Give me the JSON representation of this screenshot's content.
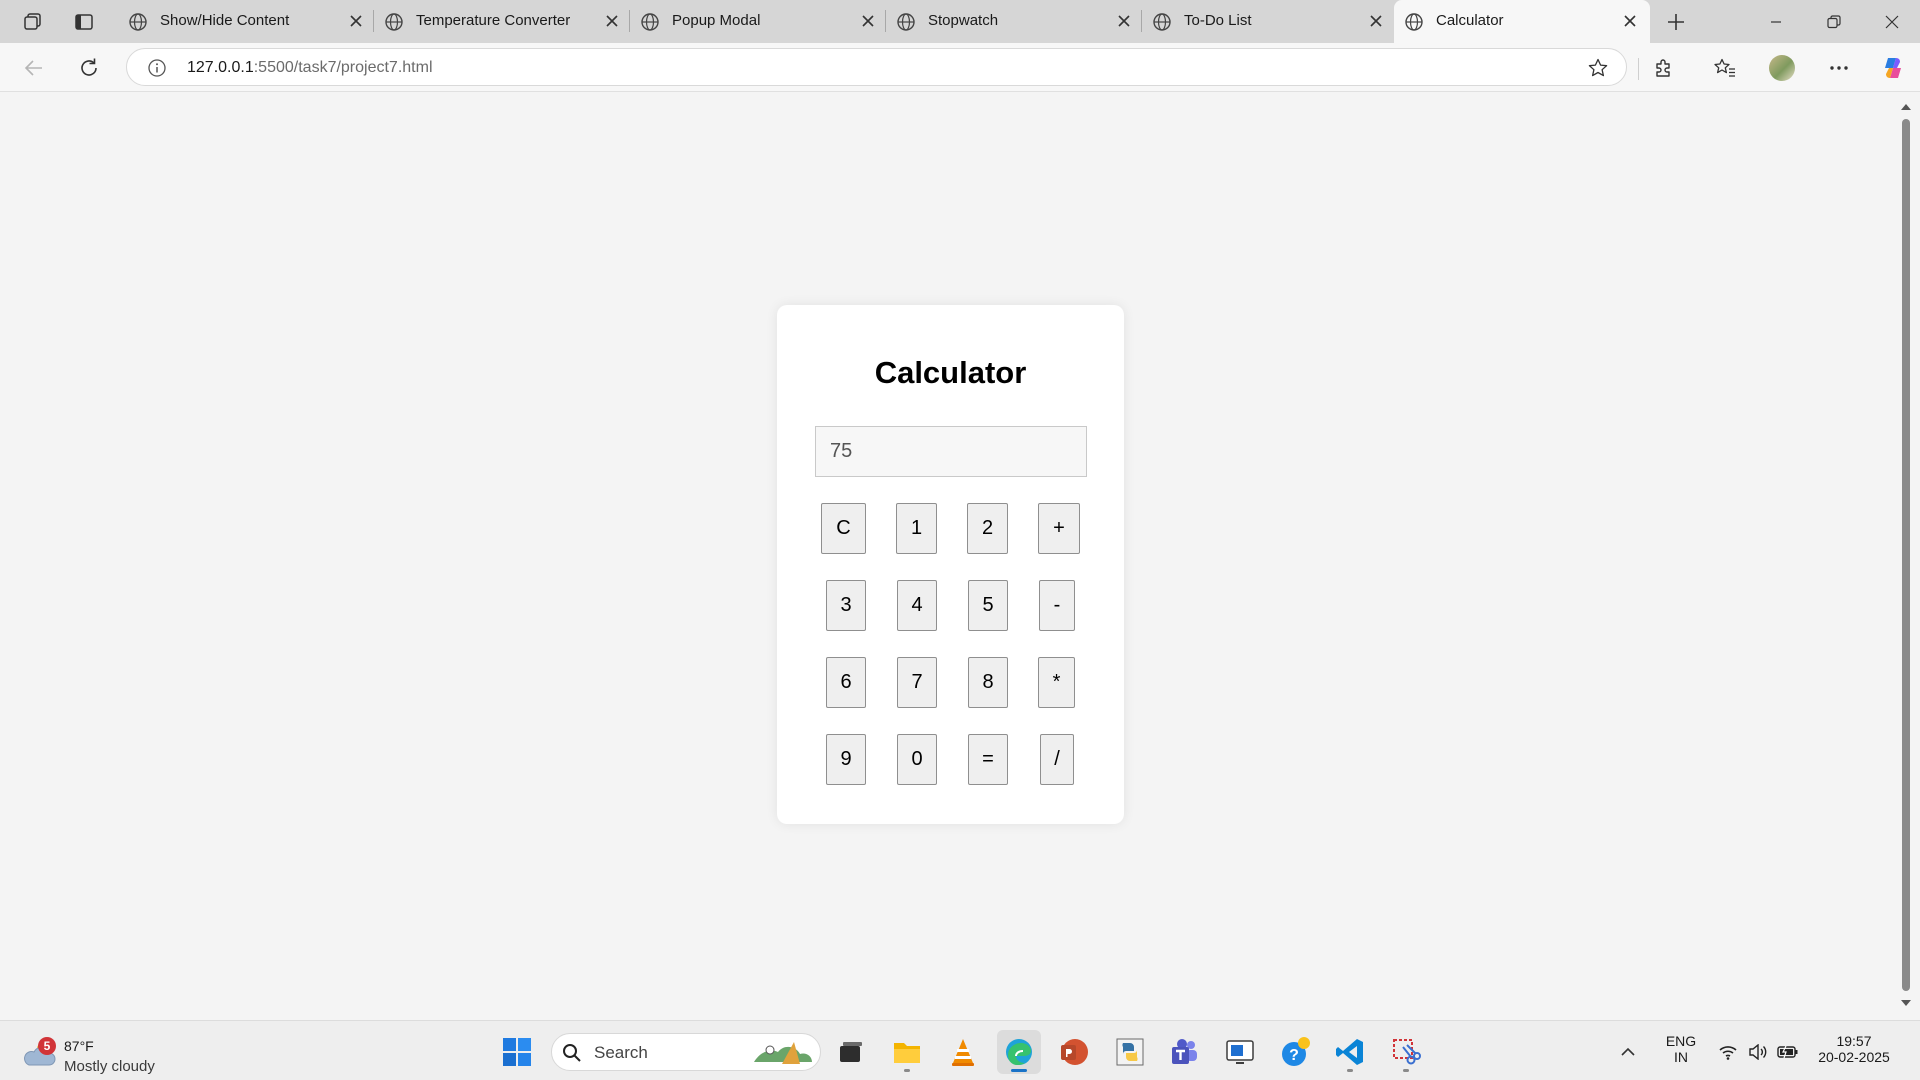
{
  "browser": {
    "tabs": [
      {
        "title": "Show/Hide Content",
        "active": false
      },
      {
        "title": "Temperature Converter",
        "active": false
      },
      {
        "title": "Popup Modal",
        "active": false
      },
      {
        "title": "Stopwatch",
        "active": false
      },
      {
        "title": "To-Do List",
        "active": false
      },
      {
        "title": "Calculator",
        "active": true
      }
    ],
    "address": {
      "host": "127.0.0.1",
      "rest": ":5500/task7/project7.html"
    },
    "icons": {
      "workspaces": "workspaces-icon",
      "tab_actions": "tab-actions-icon",
      "tab": "globe-icon",
      "new_tab": "plus-icon",
      "back": "back-arrow-icon",
      "refresh": "refresh-icon",
      "site_info": "info-icon",
      "favorite": "star-icon",
      "extensions": "puzzle-icon",
      "favorites": "favorites-icon",
      "more": "more-icon",
      "copilot": "copilot-icon"
    }
  },
  "calculator": {
    "title": "Calculator",
    "display_value": "75",
    "keys": [
      "C",
      "1",
      "2",
      "+",
      "3",
      "4",
      "5",
      "-",
      "6",
      "7",
      "8",
      "*",
      "9",
      "0",
      "=",
      "/"
    ]
  },
  "taskbar": {
    "weather": {
      "badge": "5",
      "temperature": "87°F",
      "condition": "Mostly cloudy"
    },
    "search_label": "Search",
    "tray": {
      "language_top": "ENG",
      "language_bottom": "IN",
      "time": "19:57",
      "date": "20-02-2025"
    }
  },
  "colors": {
    "page_background": "#f4f4f4",
    "card_background": "#ffffff",
    "key_background": "#efefef",
    "active_tab": "#f7f7f7",
    "accent": "#1a73c8"
  }
}
